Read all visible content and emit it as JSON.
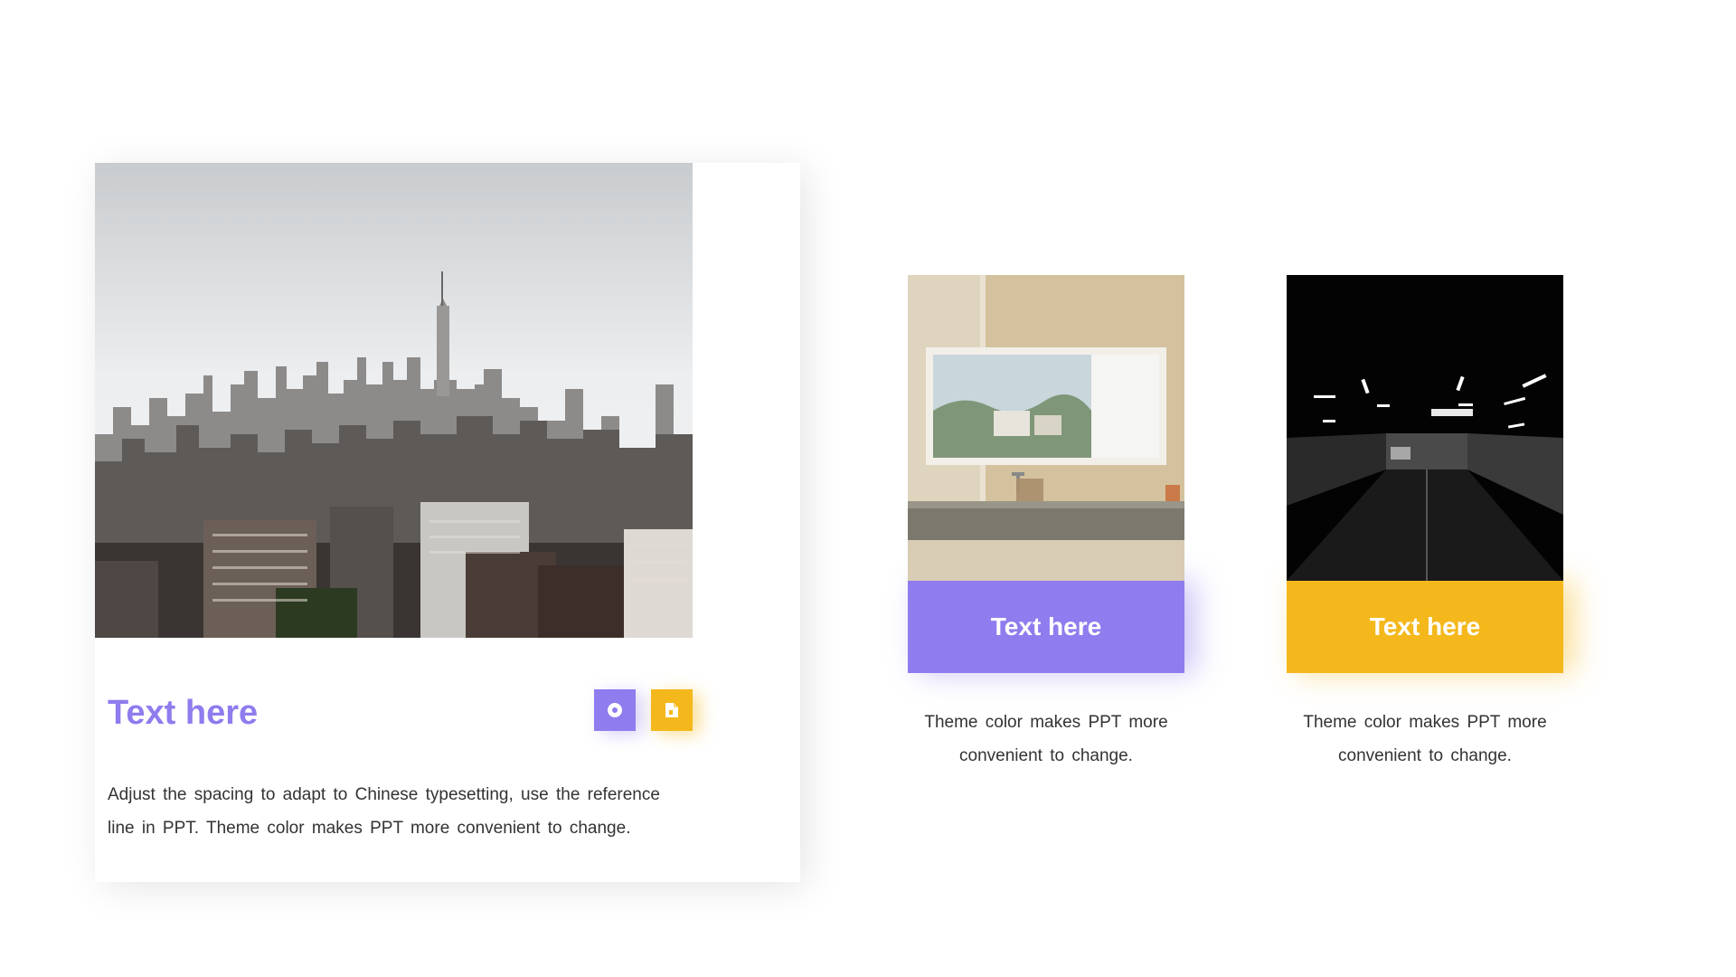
{
  "main_card": {
    "title": "Text here",
    "body": "Adjust the spacing to adapt to Chinese typesetting, use the reference line in PPT. Theme color makes PPT more convenient to change.",
    "icons": [
      "disc-icon",
      "document-icon"
    ]
  },
  "cards": [
    {
      "label": "Text here",
      "body": "Theme color makes PPT more convenient to change.",
      "color": "#8f7cee"
    },
    {
      "label": "Text here",
      "body": "Theme color makes PPT more convenient to change.",
      "color": "#f4b81c"
    }
  ],
  "colors": {
    "purple": "#8f7cee",
    "yellow": "#f4b81c",
    "text": "#333333"
  }
}
